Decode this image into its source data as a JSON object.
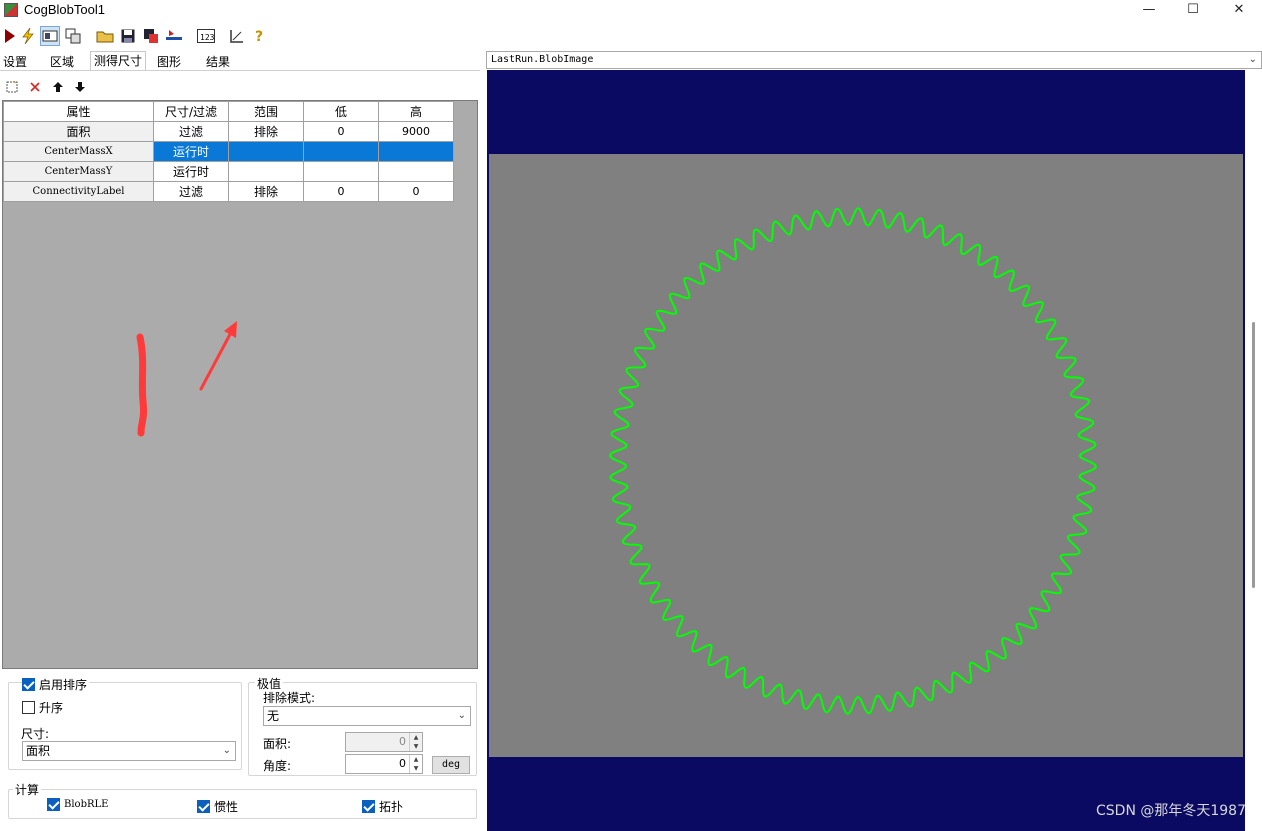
{
  "window": {
    "title": "CogBlobTool1",
    "minimize": "—",
    "maximize": "☐",
    "close": "✕"
  },
  "tabs": [
    "设置",
    "区域",
    "测得尺寸",
    "图形",
    "结果"
  ],
  "grid": {
    "headers": [
      "属性",
      "尺寸/过滤",
      "范围",
      "低",
      "高"
    ],
    "rows": [
      {
        "prop": "面积",
        "mode": "过滤",
        "range": "排除",
        "low": "0",
        "high": "9000"
      },
      {
        "prop": "CenterMassX",
        "mode": "运行时",
        "range": "",
        "low": "",
        "high": ""
      },
      {
        "prop": "CenterMassY",
        "mode": "运行时",
        "range": "",
        "low": "",
        "high": ""
      },
      {
        "prop": "ConnectivityLabel",
        "mode": "过滤",
        "range": "排除",
        "low": "0",
        "high": "0"
      }
    ]
  },
  "sort": {
    "enable_label": "启用排序",
    "enable_checked": true,
    "ascending_label": "升序",
    "ascending_checked": false,
    "size_label": "尺寸:",
    "size_value": "面积"
  },
  "extreme": {
    "group_label": "极值",
    "exclude_mode_label": "排除模式:",
    "exclude_mode_value": "无",
    "area_label": "面积:",
    "area_value": "0",
    "angle_label": "角度:",
    "angle_value": "0",
    "deg_button": "deg"
  },
  "compute": {
    "group_label": "计算",
    "items": [
      {
        "label": "BlobRLE",
        "checked": true
      },
      {
        "label": "惯性",
        "checked": true
      },
      {
        "label": "拓扑",
        "checked": true
      }
    ]
  },
  "viewer": {
    "image_select": "LastRun.BlobImage"
  },
  "colors": {
    "selection": "#0a78d7",
    "viewer_bg": "#0b0a63",
    "image_bg": "#808080",
    "blob_outline": "#00ff00",
    "annotation": "#ff3a3a"
  },
  "watermark": "CSDN @那年冬天1987"
}
